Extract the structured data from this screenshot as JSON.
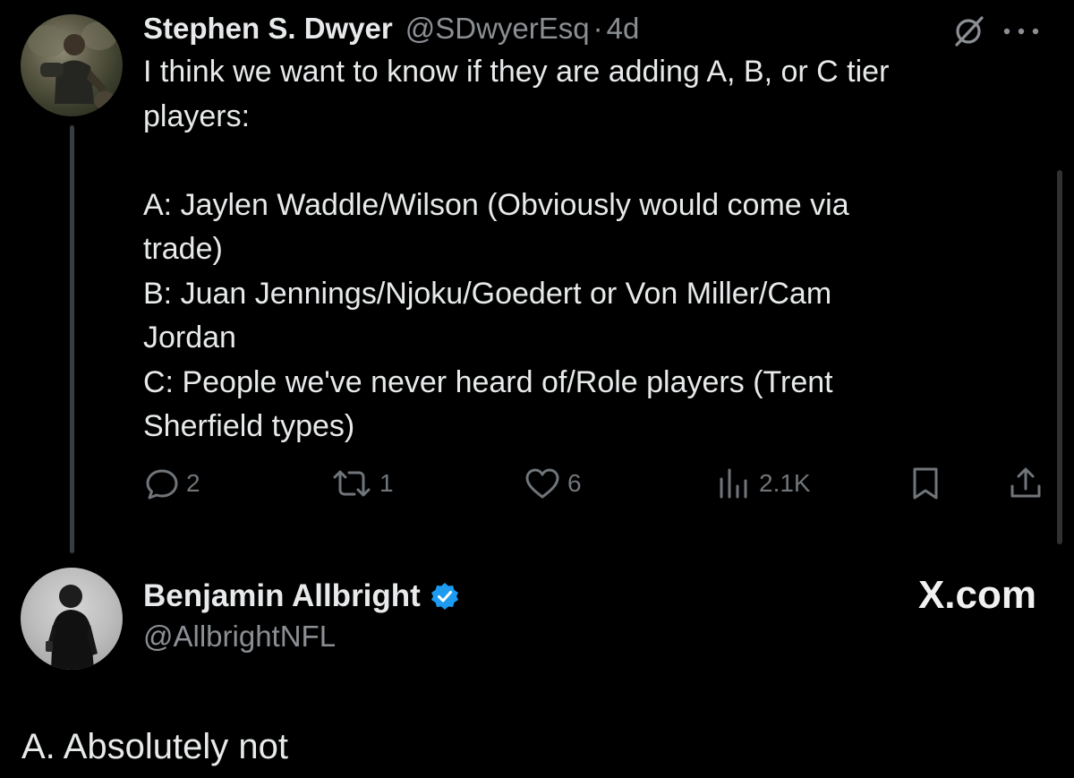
{
  "tweet": {
    "author_name": "Stephen S. Dwyer",
    "handle": "@SDwyerEsq",
    "separator": "·",
    "time": "4d",
    "lines": [
      "I think we want to know if they are adding A, B, or C tier",
      "players:",
      "",
      "A: Jaylen Waddle/Wilson (Obviously would come via",
      "trade)",
      "B: Juan Jennings/Njoku/Goedert or Von Miller/Cam",
      "Jordan",
      "C: People we've never heard of/Role players (Trent",
      "Sherfield types)"
    ],
    "actions": {
      "replies": "2",
      "reposts": "1",
      "likes": "6",
      "views": "2.1K"
    }
  },
  "reply": {
    "author_name": "Benjamin Allbright",
    "handle": "@AllbrightNFL",
    "brand": "X.com",
    "text": "A. Absolutely not"
  },
  "icons": {
    "grok": "slashed-circle-icon",
    "more": "more-horizontal-icon",
    "reply": "reply-icon",
    "repost": "repost-icon",
    "like": "heart-icon",
    "views": "views-icon",
    "bookmark": "bookmark-icon",
    "share": "share-icon",
    "verified": "verified-badge-icon"
  },
  "colors": {
    "background": "#000000",
    "text": "#e7e9ea",
    "muted": "#70757a",
    "verified": "#1d9bf0"
  }
}
